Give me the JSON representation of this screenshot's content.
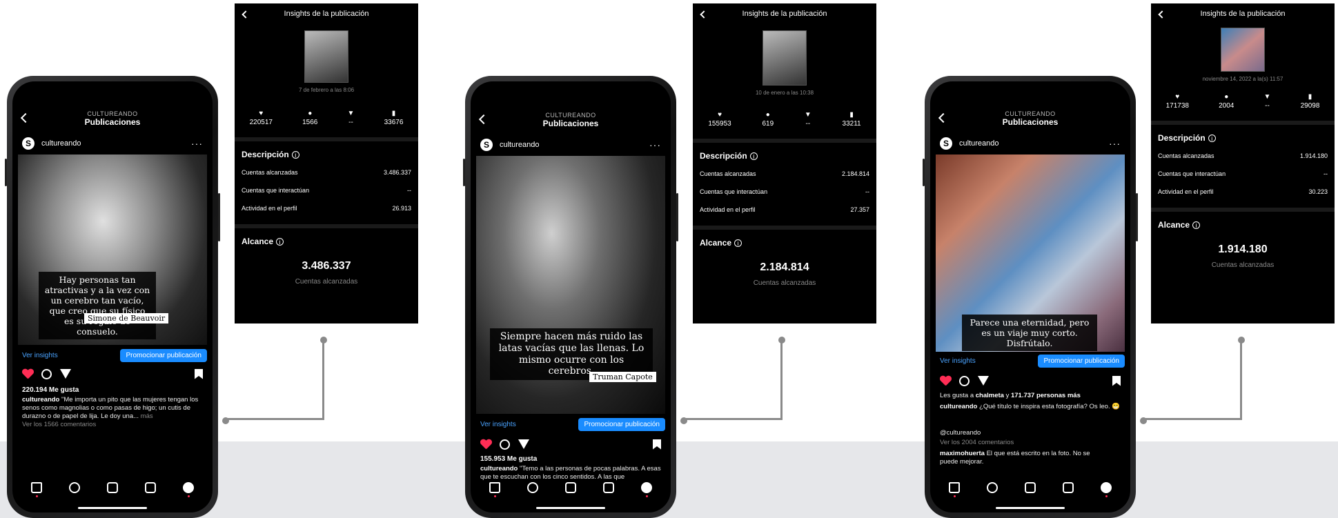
{
  "common": {
    "account_small": "CULTUREANDO",
    "page_title": "Publicaciones",
    "username": "cultureando",
    "insights_link": "Ver insights",
    "promote_button": "Promocionar publicación",
    "panel_title": "Insights de la publicación",
    "desc_title": "Descripción",
    "reach_title": "Alcance",
    "reach_sub": "Cuentas alcanzadas",
    "row1_label": "Cuentas alcanzadas",
    "row2_label": "Cuentas que interactúan",
    "row3_label": "Actividad en el perfil",
    "logo_letter": "S",
    "more_dots": "···",
    "info_glyph": "i"
  },
  "posts": [
    {
      "quote": "Hay personas tan atractivas y a la vez con un cerebro tan vacío, que creo que su físico es su regalo de consuelo.",
      "author": "Simone de Beauvoir",
      "likes": "220.194 Me gusta",
      "caption_user": "cultureando",
      "caption_text": " \"Me importa un pito que las mujeres tengan los senos como magnolias o como pasas de higo; un cutis de durazno o de papel de lija. Le doy una...",
      "caption_more": " más",
      "comments": "Ver los 1566 comentarios"
    },
    {
      "quote": "Siempre hacen más ruido las latas vacías que las llenas. Lo mismo ocurre con los cerebros.",
      "author": "Truman Capote",
      "likes": "155.953 Me gusta",
      "caption_user": "cultureando",
      "caption_text": " \"Temo a las personas de pocas palabras. A esas que te escuchan con los cinco sentidos. A las que"
    },
    {
      "quote": "Parece una eternidad, pero es un viaje muy corto. Disfrútalo.",
      "liked_by_prefix": "Les gusta a ",
      "liked_by_user": "chalmeta",
      "liked_by_mid": " y ",
      "liked_by_count": "171.737 personas más",
      "caption_user": "cultureando",
      "caption_text": " ¿Qué título te inspira esta fotografía? Os leo. 😁",
      "handle": "@cultureando",
      "comments": "Ver los 2004 comentarios",
      "comment_user": "maximohuerta",
      "comment_text": " El que está escrito en la foto. No se puede mejorar."
    }
  ],
  "panels": [
    {
      "date": "7 de febrero a las 8:06",
      "likes": "220517",
      "comments": "1566",
      "shares": "--",
      "saves": "33676",
      "reached": "3.486.337",
      "interacting": "--",
      "profile_activity": "26.913",
      "reach_big": "3.486.337"
    },
    {
      "date": "10 de enero a las 10:38",
      "likes": "155953",
      "comments": "619",
      "shares": "--",
      "saves": "33211",
      "reached": "2.184.814",
      "interacting": "--",
      "profile_activity": "27.357",
      "reach_big": "2.184.814"
    },
    {
      "date": "noviembre 14, 2022 a la(s) 11:57",
      "likes": "171738",
      "comments": "2004",
      "shares": "--",
      "saves": "29098",
      "reached": "1.914.180",
      "interacting": "--",
      "profile_activity": "30.223",
      "reach_big": "1.914.180"
    }
  ],
  "colors": {
    "accent": "#1a8cff",
    "like": "#ff2d55",
    "link": "#4aa3ff",
    "band": "#e6e7ea"
  },
  "icons": [
    "heart-icon",
    "comment-icon",
    "send-icon",
    "bookmark-icon",
    "home-icon",
    "search-icon",
    "add-icon",
    "reels-icon",
    "profile-icon",
    "back-icon",
    "info-icon"
  ]
}
